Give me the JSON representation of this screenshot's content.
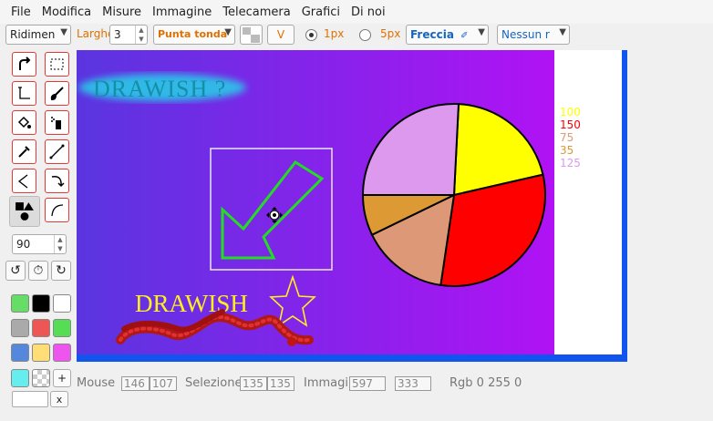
{
  "menu": {
    "items": [
      "File",
      "Modifica",
      "Misure",
      "Immagine",
      "Telecamera",
      "Grafici",
      "Di noi"
    ]
  },
  "toolbar": {
    "resize_label": "Ridimen",
    "width_label": "Larghe",
    "width_value": "3",
    "line_end_label": "Punta tonda",
    "v_button": "V",
    "size_1_label": "1px",
    "size_5_label": "5px",
    "arrow_label": "Freccia",
    "none_label": "Nessun r"
  },
  "tools": {
    "angle_value": "90",
    "add_color_label": "+",
    "clear_label": "x",
    "swatches": [
      "#66dd66",
      "#000000",
      "#ffffff",
      "#aaaaaa",
      "#ee5555",
      "#55dd55",
      "#5588dd",
      "#ffdd77",
      "#ee55ee",
      "#66eeee"
    ]
  },
  "canvas": {
    "title_text": "DRAWISH ?",
    "drawish_text": "DRAWISH",
    "legend": [
      "100",
      "150",
      "75",
      "35",
      "125"
    ],
    "legend_colors": [
      "#ffff00",
      "#ff0000",
      "#dd9977",
      "#dd9933",
      "#dd99ee"
    ]
  },
  "chart_data": {
    "type": "pie",
    "values": [
      100,
      150,
      75,
      35,
      125
    ],
    "colors": [
      "#ffff00",
      "#ff0000",
      "#dd9977",
      "#dd9933",
      "#dd99ee"
    ]
  },
  "status": {
    "mouse_label": "Mouse",
    "mouse_x": "146",
    "mouse_y": "107",
    "sel_label": "Selezione",
    "sel_w": "135",
    "sel_h": "135",
    "img_label": "Immagin",
    "img_w": "597",
    "img_h": "333",
    "rgb_label": "Rgb 0 255 0"
  }
}
